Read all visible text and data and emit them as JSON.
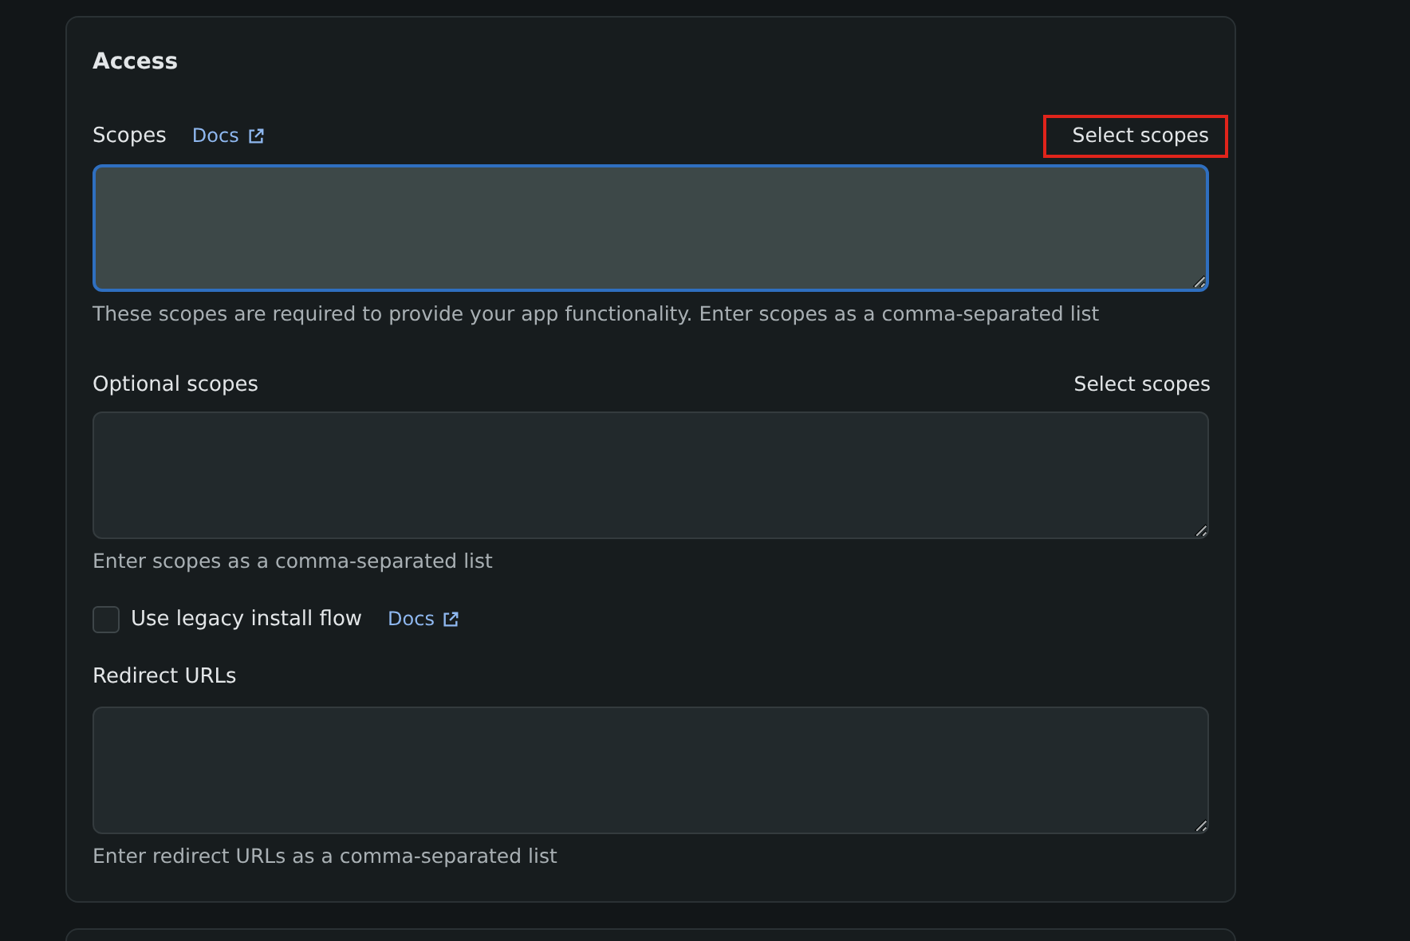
{
  "section": {
    "title": "Access"
  },
  "fields": [
    {
      "label": "Scopes",
      "docs": "Docs",
      "action": {
        "label": "Select scopes",
        "highlighted": true
      },
      "focused": true,
      "help": "These scopes are required to provide your app functionality. Enter scopes as a comma-separated list"
    },
    {
      "label": "Optional scopes",
      "action": {
        "label": "Select scopes",
        "highlighted": false
      },
      "focused": false,
      "help": "Enter scopes as a comma-separated list"
    }
  ],
  "legacy": {
    "label": "Use legacy install flow",
    "checked": false,
    "docs": "Docs"
  },
  "redirect": {
    "label": "Redirect URLs",
    "help": "Enter redirect URLs as a comma-separated list"
  }
}
